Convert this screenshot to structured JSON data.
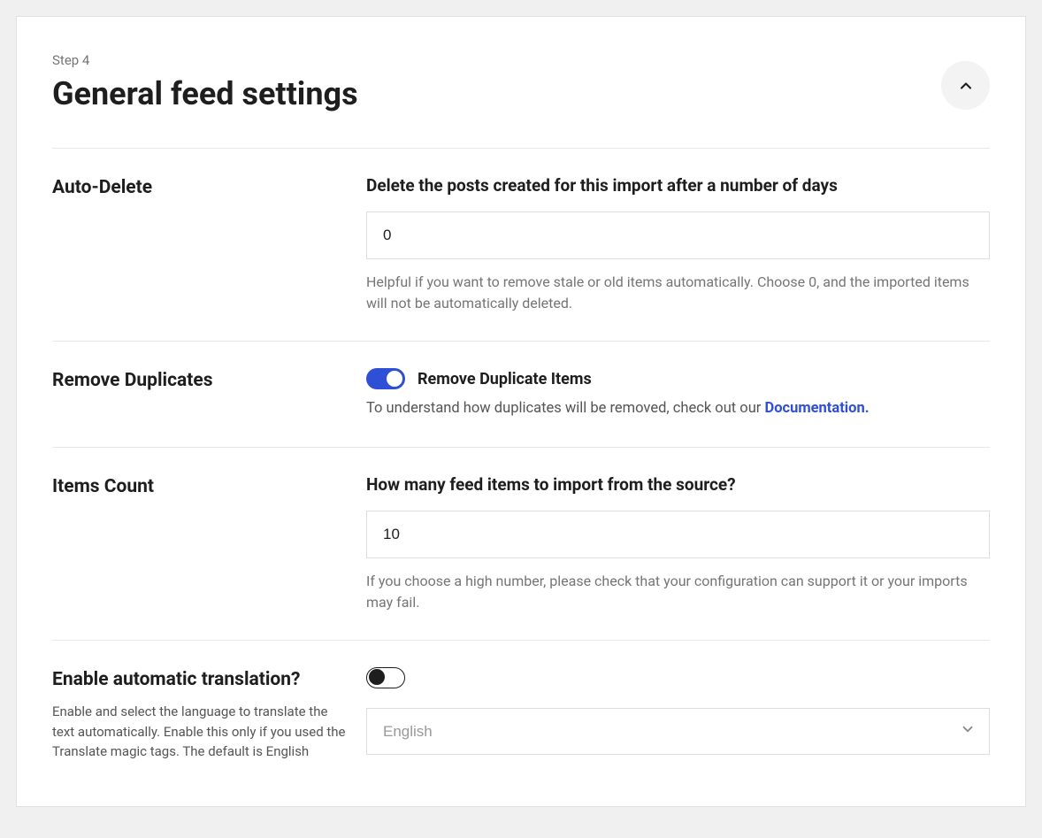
{
  "header": {
    "step_label": "Step 4",
    "title": "General feed settings"
  },
  "sections": {
    "auto_delete": {
      "label": "Auto-Delete",
      "field_label": "Delete the posts created for this import after a number of days",
      "value": "0",
      "help": "Helpful if you want to remove stale or old items automatically. Choose 0, and the imported items will not be automatically deleted."
    },
    "remove_duplicates": {
      "label": "Remove Duplicates",
      "toggle_label": "Remove Duplicate Items",
      "toggle_on": true,
      "info_prefix": "To understand how duplicates will be removed, check out our ",
      "link_text": "Documentation."
    },
    "items_count": {
      "label": "Items Count",
      "field_label": "How many feed items to import from the source?",
      "value": "10",
      "help": "If you choose a high number, please check that your configuration can support it or your imports may fail."
    },
    "translation": {
      "label": "Enable automatic translation?",
      "sub": "Enable and select the language to translate the text automatically. Enable this only if you used the Translate magic tags. The default is English",
      "toggle_on": false,
      "selected": "English"
    }
  }
}
